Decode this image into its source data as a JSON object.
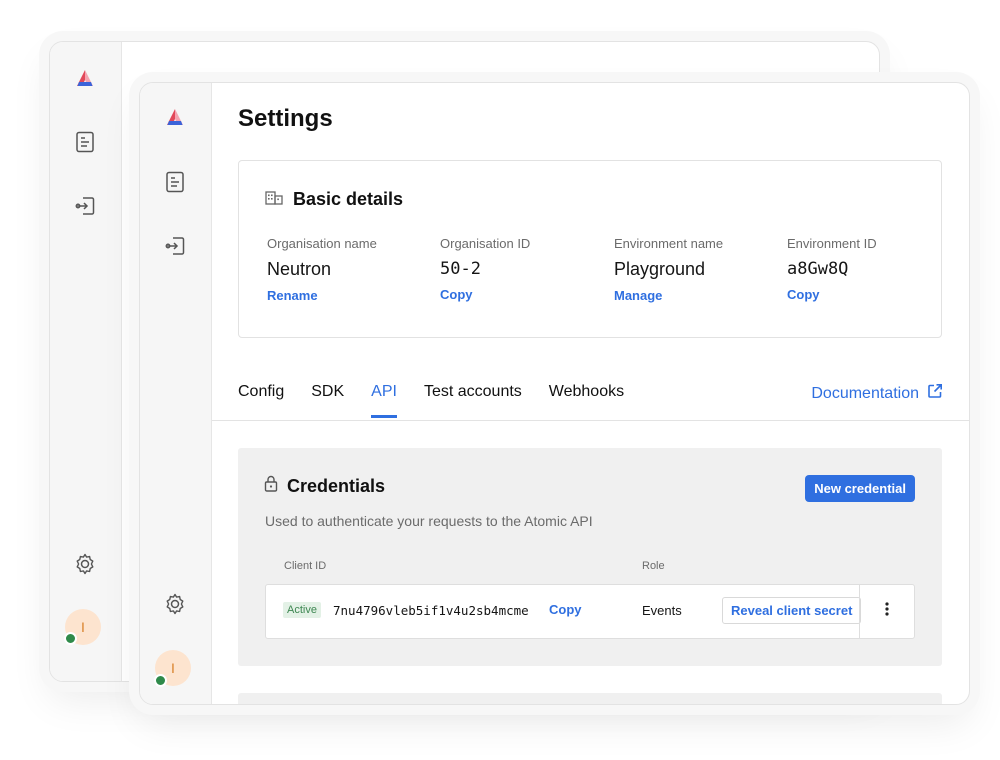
{
  "app": {
    "logo_icon": "atomic-logo-icon",
    "sidebar": [
      {
        "icon": "document-icon",
        "name": "sidebar-item-content"
      },
      {
        "icon": "login-arrow-icon",
        "name": "sidebar-item-sign-in"
      },
      {
        "icon": "gear-icon",
        "name": "sidebar-item-settings"
      }
    ],
    "user_initial": "I",
    "presence_color": "#2f8a4a"
  },
  "page_title": "Settings",
  "basic_details": {
    "title": "Basic details",
    "fields": [
      {
        "label": "Organisation name",
        "value": "Neutron",
        "action": "Rename"
      },
      {
        "label": "Organisation ID",
        "value": "50-2",
        "action": "Copy"
      },
      {
        "label": "Environment name",
        "value": "Playground",
        "action": "Manage"
      },
      {
        "label": "Environment ID",
        "value": "a8Gw8Q",
        "action": "Copy"
      }
    ]
  },
  "tabs": [
    {
      "label": "Config",
      "active": false
    },
    {
      "label": "SDK",
      "active": false
    },
    {
      "label": "API",
      "active": true
    },
    {
      "label": "Test accounts",
      "active": false
    },
    {
      "label": "Webhooks",
      "active": false
    }
  ],
  "documentation_link": "Documentation",
  "credentials": {
    "title": "Credentials",
    "new_button": "New credential",
    "subtitle": "Used to authenticate your requests to the Atomic API",
    "columns": {
      "client_id": "Client ID",
      "role": "Role"
    },
    "rows": [
      {
        "status": "Active",
        "client_id": "7nu4796vleb5if1v4u2sb4mcme",
        "copy": "Copy",
        "role": "Events",
        "reveal": "Reveal client secret"
      }
    ]
  },
  "colors": {
    "accent": "#2f6fe0",
    "active_badge_bg": "#e3f1e6",
    "active_badge_text": "#3e8752"
  }
}
